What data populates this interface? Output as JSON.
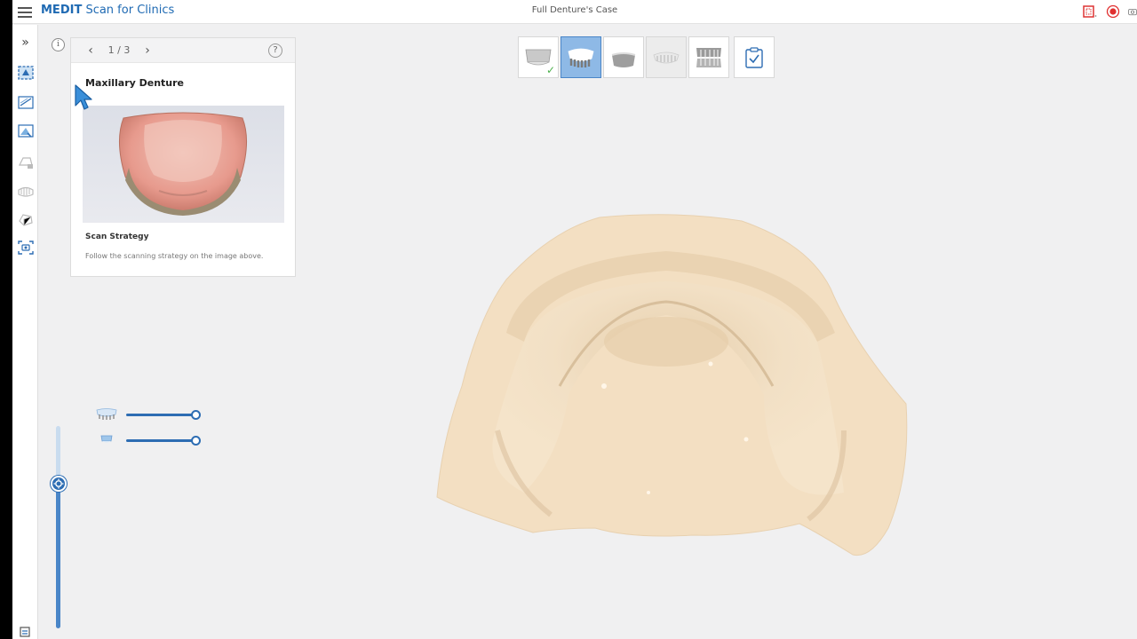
{
  "app": {
    "brand": "MEDIT",
    "name": " Scan for Clinics",
    "window_title": "Full Denture's Case"
  },
  "guide": {
    "page": "1 / 3",
    "title": "Maxillary Denture",
    "strategy_title": "Scan Strategy",
    "strategy_text": "Follow the scanning strategy on the image above."
  },
  "stages": [
    {
      "name": "stage-mandible",
      "state": "completed"
    },
    {
      "name": "stage-maxillary-denture",
      "state": "active"
    },
    {
      "name": "stage-base",
      "state": "normal"
    },
    {
      "name": "stage-denture-teeth",
      "state": "disabled"
    },
    {
      "name": "stage-occlusion",
      "state": "normal"
    },
    {
      "name": "stage-complete",
      "state": "normal"
    }
  ],
  "layers": [
    {
      "name": "upper-denture",
      "opacity": 1.0
    },
    {
      "name": "lower-base",
      "opacity": 1.0
    }
  ],
  "colors": {
    "accent": "#2d6db3",
    "model": "#f3dfc2",
    "active_stage": "#8eb9e6",
    "check": "#4cb04c",
    "record": "#e03030"
  }
}
